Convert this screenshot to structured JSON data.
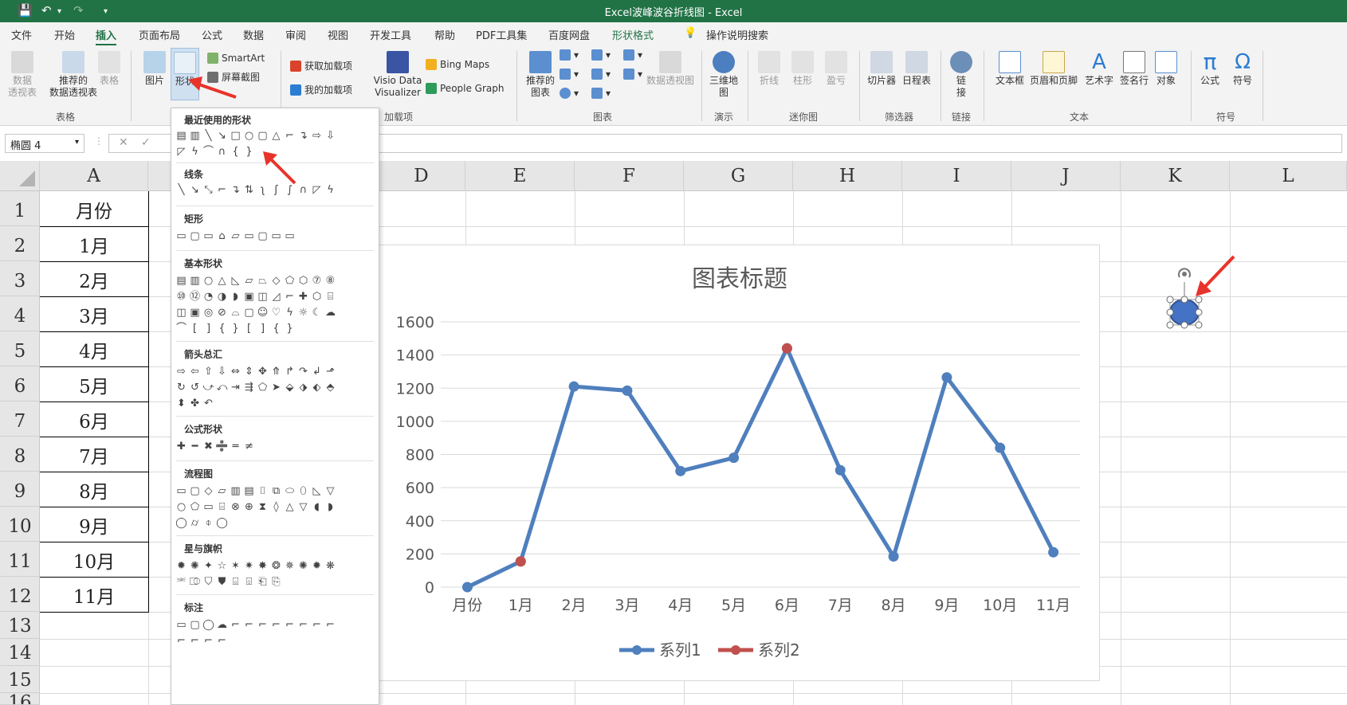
{
  "titlebar": {
    "title": "Excel波峰波谷折线图  -  Excel"
  },
  "tabs": [
    "文件",
    "开始",
    "插入",
    "页面布局",
    "公式",
    "数据",
    "审阅",
    "视图",
    "开发工具",
    "帮助",
    "PDF工具集",
    "百度网盘",
    "形状格式"
  ],
  "tell_me": "操作说明搜索",
  "ribbon": {
    "pivot": "数据\n透视表",
    "recommended_pivot": "推荐的\n数据透视表",
    "table": "表格",
    "picture": "图片",
    "shapes": "形状",
    "smartart": "SmartArt",
    "screenshot": "屏幕截图",
    "get_addins": "获取加载项",
    "my_addins": "我的加载项",
    "visio": "Visio Data\nVisualizer",
    "bing": "Bing Maps",
    "people": "People Graph",
    "rec_charts": "推荐的\n图表",
    "pivotchart": "数据透视图",
    "map3d": "三维地\n图",
    "line": "折线",
    "column": "柱形",
    "winloss": "盈亏",
    "slicer": "切片器",
    "timeline": "日程表",
    "link": "链\n接",
    "textbox": "文本框",
    "headerfooter": "页眉和页脚",
    "wordart": "艺术字",
    "signature": "签名行",
    "object": "对象",
    "equation": "公式",
    "symbol": "符号",
    "groups": {
      "tables": "表格",
      "addins": "加载项",
      "charts": "图表",
      "tours": "演示",
      "sparklines": "迷你图",
      "filters": "筛选器",
      "links": "链接",
      "text": "文本",
      "symbols": "符号"
    }
  },
  "namebox": "椭圆 4",
  "columns": [
    "A",
    "D",
    "E",
    "F",
    "G",
    "H",
    "I",
    "J",
    "K",
    "L"
  ],
  "rows": [
    "1",
    "2",
    "3",
    "4",
    "5",
    "6",
    "7",
    "8",
    "9",
    "10",
    "11",
    "12",
    "13",
    "14",
    "15",
    "16"
  ],
  "columnA": [
    "月份",
    "1月",
    "2月",
    "3月",
    "4月",
    "5月",
    "6月",
    "7月",
    "8月",
    "9月",
    "10月",
    "11月"
  ],
  "shapes_menu": {
    "recent": "最近使用的形状",
    "lines": "线条",
    "rect": "矩形",
    "basic": "基本形状",
    "arrows": "箭头总汇",
    "equation": "公式形状",
    "flowchart": "流程图",
    "stars": "星与旗帜",
    "callouts": "标注"
  },
  "chart_data": {
    "type": "line",
    "title": "图表标题",
    "categories": [
      "月份",
      "1月",
      "2月",
      "3月",
      "4月",
      "5月",
      "6月",
      "7月",
      "8月",
      "9月",
      "10月",
      "11月"
    ],
    "ylim": [
      0,
      1600
    ],
    "yticks": [
      0,
      200,
      400,
      600,
      800,
      1000,
      1200,
      1400,
      1600
    ],
    "grid": true,
    "legend": "bottom",
    "series": [
      {
        "name": "系列1",
        "color": "#4f7fbd",
        "values": [
          0,
          155,
          1210,
          1185,
          700,
          780,
          1440,
          705,
          185,
          1265,
          840,
          210
        ]
      },
      {
        "name": "系列2",
        "color": "#c0504d",
        "values": [
          null,
          155,
          null,
          null,
          null,
          null,
          1440,
          null,
          null,
          null,
          null,
          null
        ]
      }
    ]
  }
}
